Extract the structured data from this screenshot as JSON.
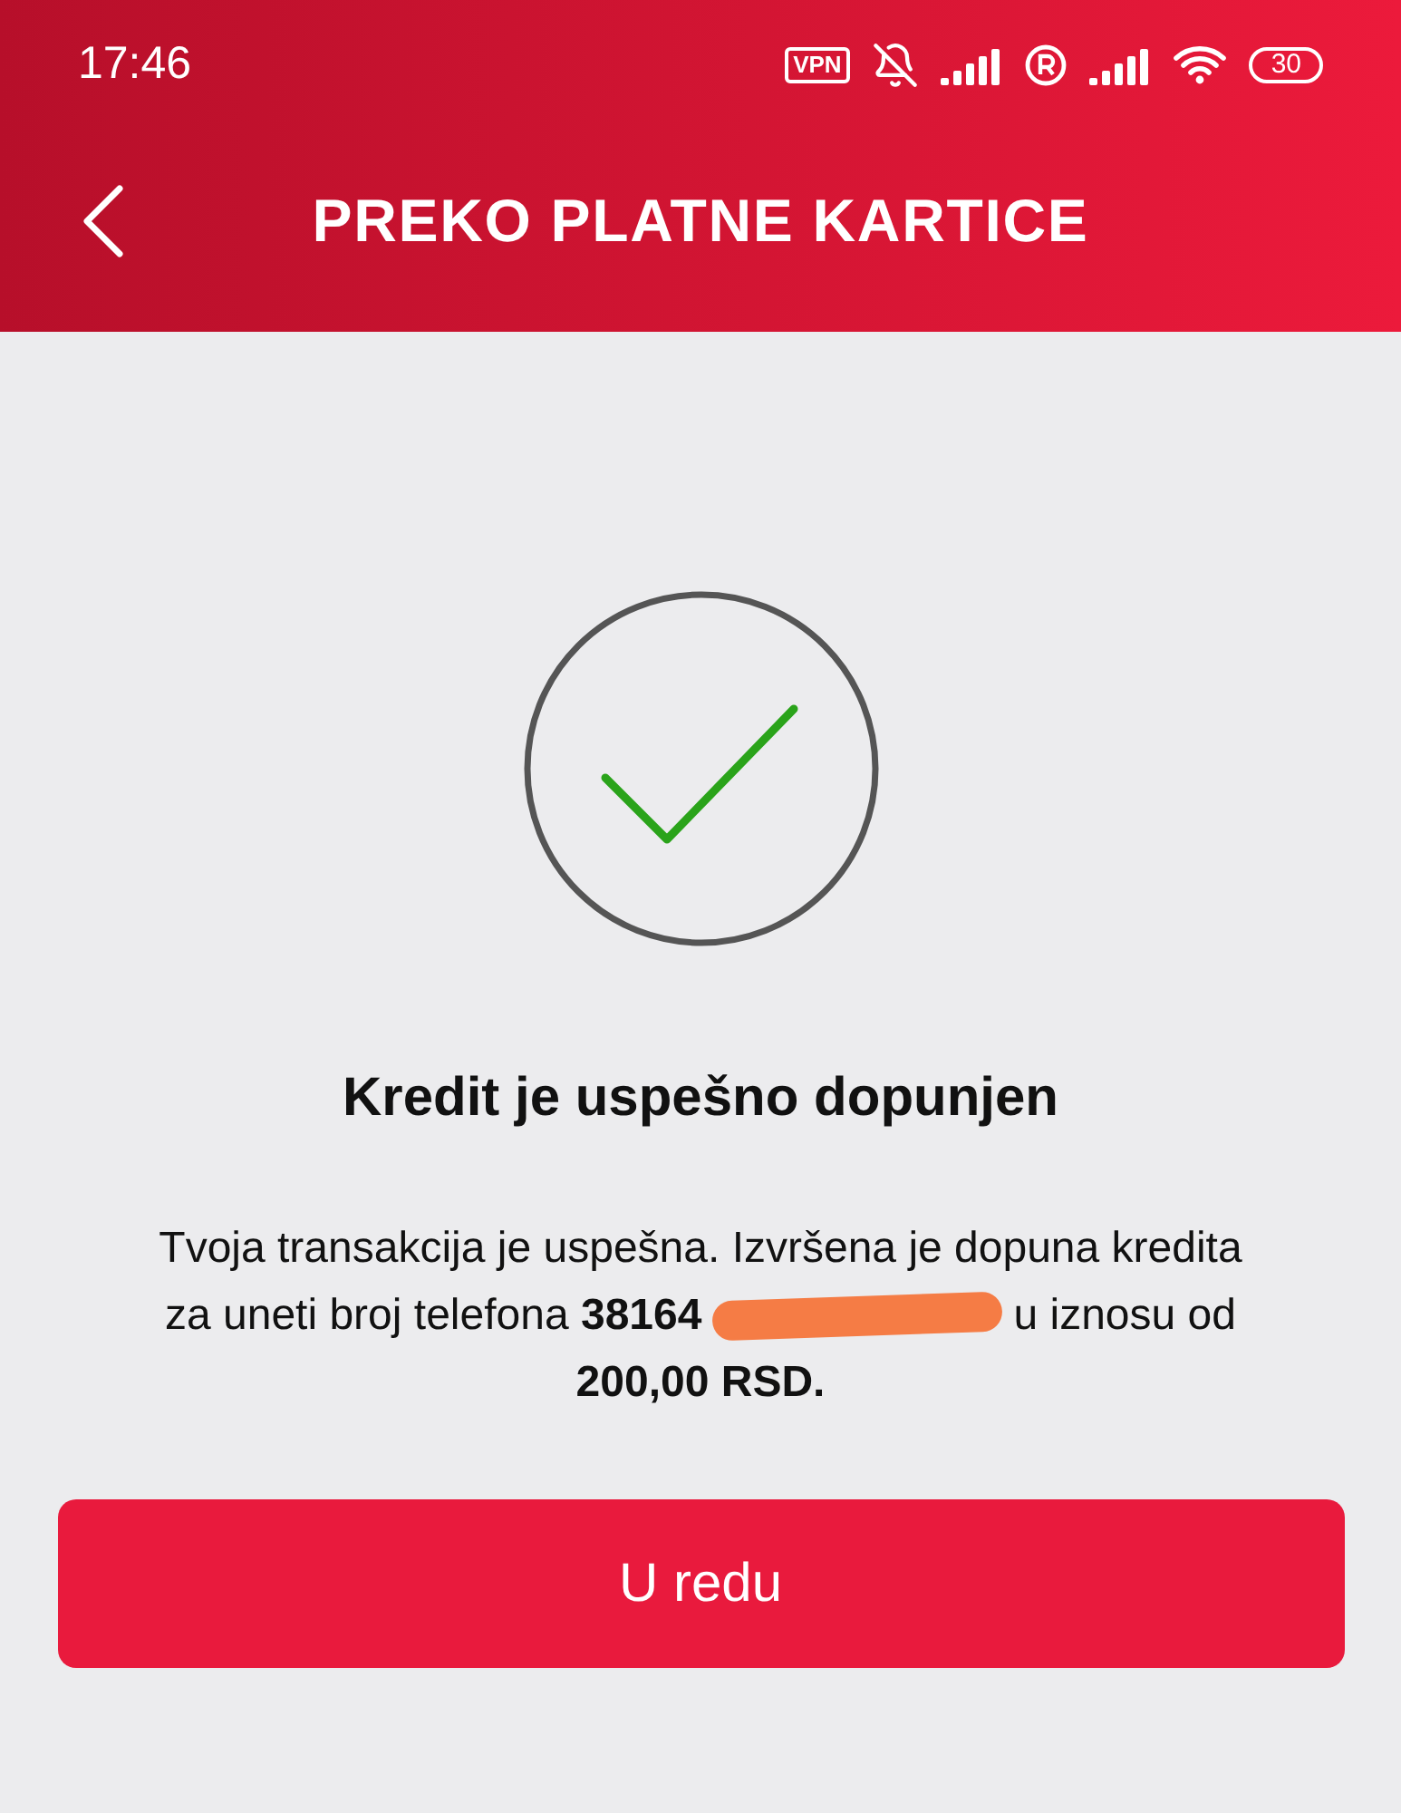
{
  "status_bar": {
    "time": "17:46",
    "vpn": "VPN",
    "battery": "30"
  },
  "header": {
    "title": "PREKO PLATNE KARTICE"
  },
  "result": {
    "title": "Kredit je uspešno dopunjen",
    "message_line_1": "Tvoja transakcija je uspešna. Izvršena je dopuna kredita",
    "message_before": "za uneti broj telefona **38164**",
    "message_after": "u iznosu od",
    "message_line_3": "**200,00 RSD.**"
  },
  "buttons": [
    {
      "label": "U redu"
    }
  ]
}
